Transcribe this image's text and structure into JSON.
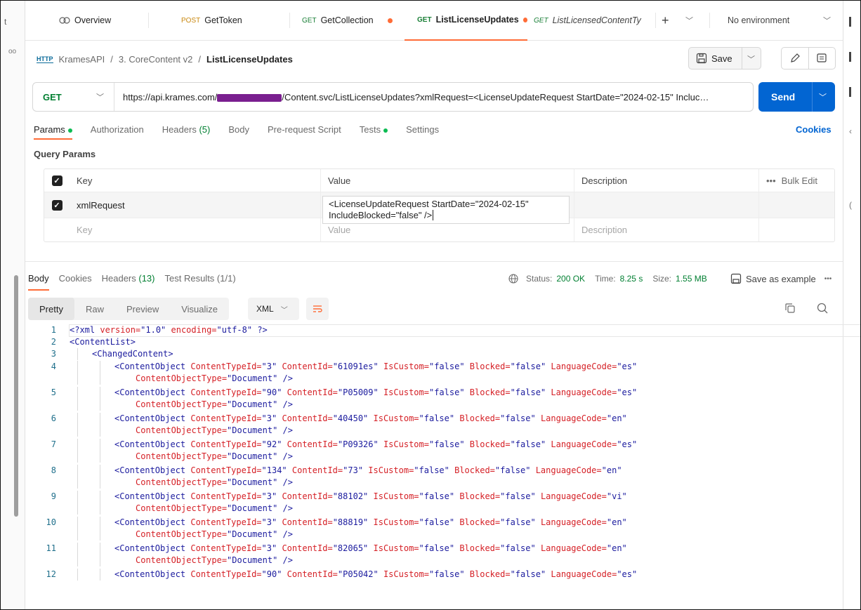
{
  "sidebar_stub": {
    "letter": "t",
    "dots": "oo"
  },
  "tabs": [
    {
      "method": "",
      "label": "Overview",
      "italic": false,
      "dot": false
    },
    {
      "method": "POST",
      "label": "GetToken",
      "italic": false,
      "dot": false
    },
    {
      "method": "GET",
      "label": "GetCollection",
      "italic": false,
      "dot": true
    },
    {
      "method": "GET",
      "label": "ListLicenseUpdates",
      "italic": false,
      "dot": true,
      "active": true
    },
    {
      "method": "GET",
      "label": "ListLicensedContentTy",
      "italic": true,
      "dot": false
    }
  ],
  "env": {
    "label": "No environment"
  },
  "breadcrumb": {
    "icon_text": "HTTP",
    "parts": [
      "KramesAPI",
      "3. CoreContent v2"
    ],
    "current": "ListLicenseUpdates"
  },
  "toolbar": {
    "save_label": "Save"
  },
  "request": {
    "method": "GET",
    "url_prefix": "https://api.krames.com/",
    "url_suffix": "/Content.svc/ListLicenseUpdates?xmlRequest=<LicenseUpdateRequest StartDate=\"2024-02-15\" Incluc…",
    "send_label": "Send"
  },
  "request_tabs": {
    "params": "Params",
    "authorization": "Authorization",
    "headers": "Headers",
    "headers_count": "(5)",
    "body": "Body",
    "prerequest": "Pre-request Script",
    "tests": "Tests",
    "settings": "Settings",
    "cookies": "Cookies"
  },
  "query_params": {
    "title": "Query Params",
    "headers": {
      "key": "Key",
      "value": "Value",
      "description": "Description",
      "bulk": "Bulk Edit"
    },
    "rows": [
      {
        "key": "xmlRequest",
        "value_line1": "<LicenseUpdateRequest StartDate=\"2024-02-15\"",
        "value_line2": "IncludeBlocked=\"false\" />",
        "checked": true
      }
    ],
    "placeholders": {
      "key": "Key",
      "value": "Value",
      "description": "Description"
    }
  },
  "response": {
    "tabs": {
      "body": "Body",
      "cookies": "Cookies",
      "headers": "Headers",
      "headers_count": "(13)",
      "tests": "Test Results (1/1)"
    },
    "status_label": "Status:",
    "status_value": "200 OK",
    "time_label": "Time:",
    "time_value": "8.25 s",
    "size_label": "Size:",
    "size_value": "1.55 MB",
    "save_example": "Save as example",
    "views": [
      "Pretty",
      "Raw",
      "Preview",
      "Visualize"
    ],
    "active_view": "Pretty",
    "format": "XML"
  },
  "code_lines": [
    {
      "n": "1",
      "indent": 0,
      "segs": [
        [
          "tag",
          "<?xml "
        ],
        [
          "attr",
          "version="
        ],
        [
          "str",
          "\"1.0\""
        ],
        [
          "attr",
          " encoding="
        ],
        [
          "str",
          "\"utf-8\""
        ],
        [
          "tag",
          " ?>"
        ]
      ]
    },
    {
      "n": "2",
      "indent": 0,
      "segs": [
        [
          "tag",
          "<ContentList>"
        ]
      ]
    },
    {
      "n": "3",
      "indent": 1,
      "segs": [
        [
          "tag",
          "<ChangedContent>"
        ]
      ]
    },
    {
      "n": "4",
      "indent": 2,
      "id": "61091es",
      "lang": "es",
      "type": "3"
    },
    {
      "n": "5",
      "indent": 2,
      "id": "P05009",
      "lang": "es",
      "type": "90"
    },
    {
      "n": "6",
      "indent": 2,
      "id": "40450",
      "lang": "en",
      "type": "3"
    },
    {
      "n": "7",
      "indent": 2,
      "id": "P09326",
      "lang": "es",
      "type": "92"
    },
    {
      "n": "8",
      "indent": 2,
      "id": "73",
      "lang": "en",
      "type": "134"
    },
    {
      "n": "9",
      "indent": 2,
      "id": "88102",
      "lang": "vi",
      "type": "3"
    },
    {
      "n": "10",
      "indent": 2,
      "id": "88819",
      "lang": "en",
      "type": "3"
    },
    {
      "n": "11",
      "indent": 2,
      "id": "82065",
      "lang": "en",
      "type": "3"
    },
    {
      "n": "12",
      "indent": 2,
      "id": "P05042",
      "lang": "es",
      "type": "90",
      "noWrapLine": true
    }
  ],
  "colors": {
    "accent": "#ff6c37",
    "send": "#0265d2",
    "get": "#007f31",
    "post": "#c9880f"
  }
}
